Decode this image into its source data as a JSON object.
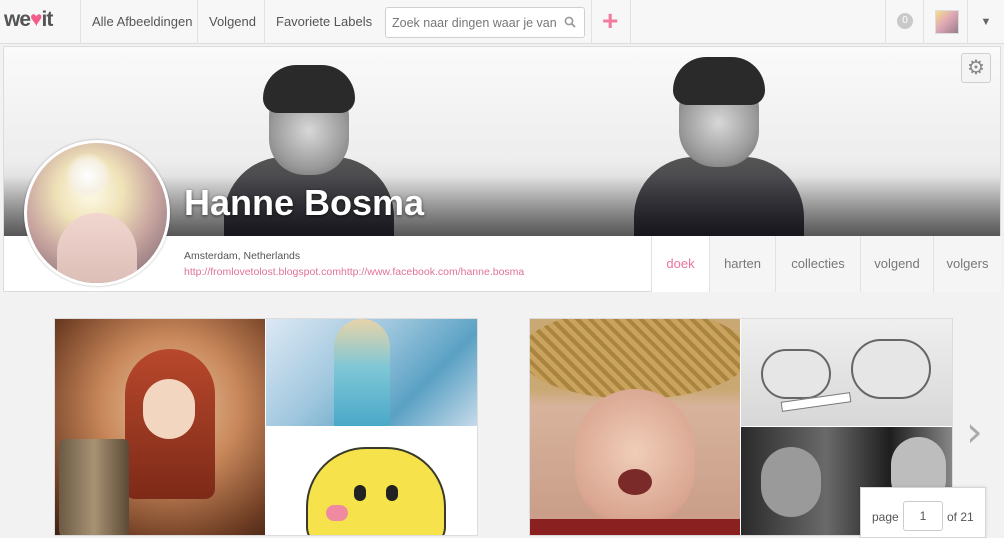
{
  "nav": {
    "logo_left": "we",
    "logo_right": "it",
    "links": [
      "Alle Afbeeldingen",
      "Volgend",
      "Favoriete Labels"
    ],
    "search_placeholder": "Zoek naar dingen waar je van",
    "plus_label": "+",
    "notification_count": "0",
    "caret": "▼"
  },
  "profile": {
    "name": "Hanne Bosma",
    "location": "Amsterdam, Netherlands",
    "links": "http://fromlovetolost.blogspot.comhttp://www.facebook.com/hanne.bosma",
    "tabs": [
      "doek",
      "harten",
      "collecties",
      "volgend",
      "volgers"
    ],
    "active_tab": "doek"
  },
  "pager": {
    "page_label": "page",
    "current_page": "1",
    "total_label": "of 21"
  },
  "colors": {
    "brand_pink": "#f25d8a",
    "tab_active": "#f0729a"
  }
}
